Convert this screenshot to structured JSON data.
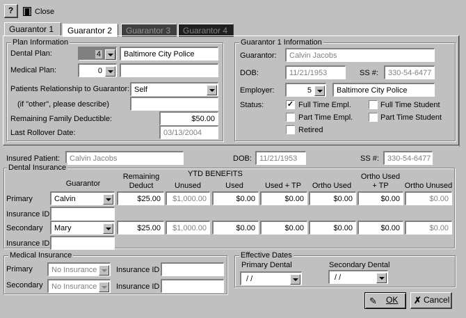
{
  "toolbar": {
    "help_label": "?",
    "close_label": "Close"
  },
  "tabs": [
    {
      "label": "Guarantor 1",
      "color": "#c0c0c0",
      "text": "#000000"
    },
    {
      "label": "Guarantor 2",
      "color": "#ffffff",
      "text": "#000000"
    },
    {
      "label": "Guarantor 3",
      "color": "#404040",
      "text": "#808080"
    },
    {
      "label": "Guarantor 4",
      "color": "#202020",
      "text": "#808080"
    }
  ],
  "plan": {
    "title": "Plan Information",
    "dental_label": "Dental Plan:",
    "dental_value": "4",
    "dental_name": "Baltimore City Police",
    "medical_label": "Medical Plan:",
    "medical_value": "0",
    "medical_name": "",
    "relationship_label": "Patients Relationship to Guarantor:",
    "relationship_value": "Self",
    "other_label": "(if \"other\", please describe)",
    "other_value": "",
    "deductible_label": "Remaining Family Deductible:",
    "deductible_value": "$50.00",
    "rollover_label": "Last Rollover Date:",
    "rollover_value": "03/13/2004"
  },
  "guarantor": {
    "title": "Guarantor 1 Information",
    "name_label": "Guarantor:",
    "name_value": "Calvin Jacobs",
    "dob_label": "DOB:",
    "dob_value": "11/21/1953",
    "ss_label": "SS #:",
    "ss_value": "330-54-6477",
    "employer_label": "Employer:",
    "employer_value": "5",
    "employer_name": "Baltimore City  Police",
    "status_label": "Status:",
    "status": [
      {
        "label": "Full Time Empl.",
        "checked": true
      },
      {
        "label": "Full Time Student",
        "checked": false
      },
      {
        "label": "Part Time Empl.",
        "checked": false
      },
      {
        "label": "Part Time Student",
        "checked": false
      },
      {
        "label": "Retired",
        "checked": false
      }
    ]
  },
  "patient": {
    "label": "Insured Patient:",
    "value": "Calvin Jacobs",
    "dob_label": "DOB:",
    "dob_value": "11/21/1953",
    "ss_label": "SS #:",
    "ss_value": "330-54-6477"
  },
  "dental": {
    "title": "Dental Insurance",
    "ytd_label": "YTD BENEFITS",
    "headers": {
      "guarantor": "Guarantor",
      "remaining": "Remaining\nDeduct",
      "unused": "Unused",
      "used": "Used",
      "used_tp": "Used + TP",
      "ortho_used": "Ortho Used",
      "ortho_used_tp": "Ortho Used\n+ TP",
      "ortho_unused": "Ortho Unused"
    },
    "insurance_id_label": "Insurance ID",
    "rows": [
      {
        "label": "Primary",
        "guarantor": "Calvin",
        "remaining": "$25.00",
        "unused": "$1,000.00",
        "used": "$0.00",
        "used_tp": "$0.00",
        "ortho_used": "$0.00",
        "ortho_used_tp": "$0.00",
        "ortho_unused": "$0.00",
        "insurance_id": ""
      },
      {
        "label": "Secondary",
        "guarantor": "Mary",
        "remaining": "$25.00",
        "unused": "$1,000.00",
        "used": "$0.00",
        "used_tp": "$0.00",
        "ortho_used": "$0.00",
        "ortho_used_tp": "$0.00",
        "ortho_unused": "$0.00",
        "insurance_id": ""
      }
    ]
  },
  "medical": {
    "title": "Medical Insurance",
    "primary_label": "Primary",
    "primary_value": "No Insurance",
    "secondary_label": "Secondary",
    "secondary_value": "No Insurance",
    "id_label": "Insurance ID",
    "primary_id": "",
    "secondary_id": ""
  },
  "effective": {
    "title": "Effective Dates",
    "primary_label": "Primary Dental",
    "primary_value": " / /",
    "secondary_label": "Secondary Dental",
    "secondary_value": " / /"
  },
  "buttons": {
    "ok": "OK",
    "cancel": "Cancel"
  }
}
